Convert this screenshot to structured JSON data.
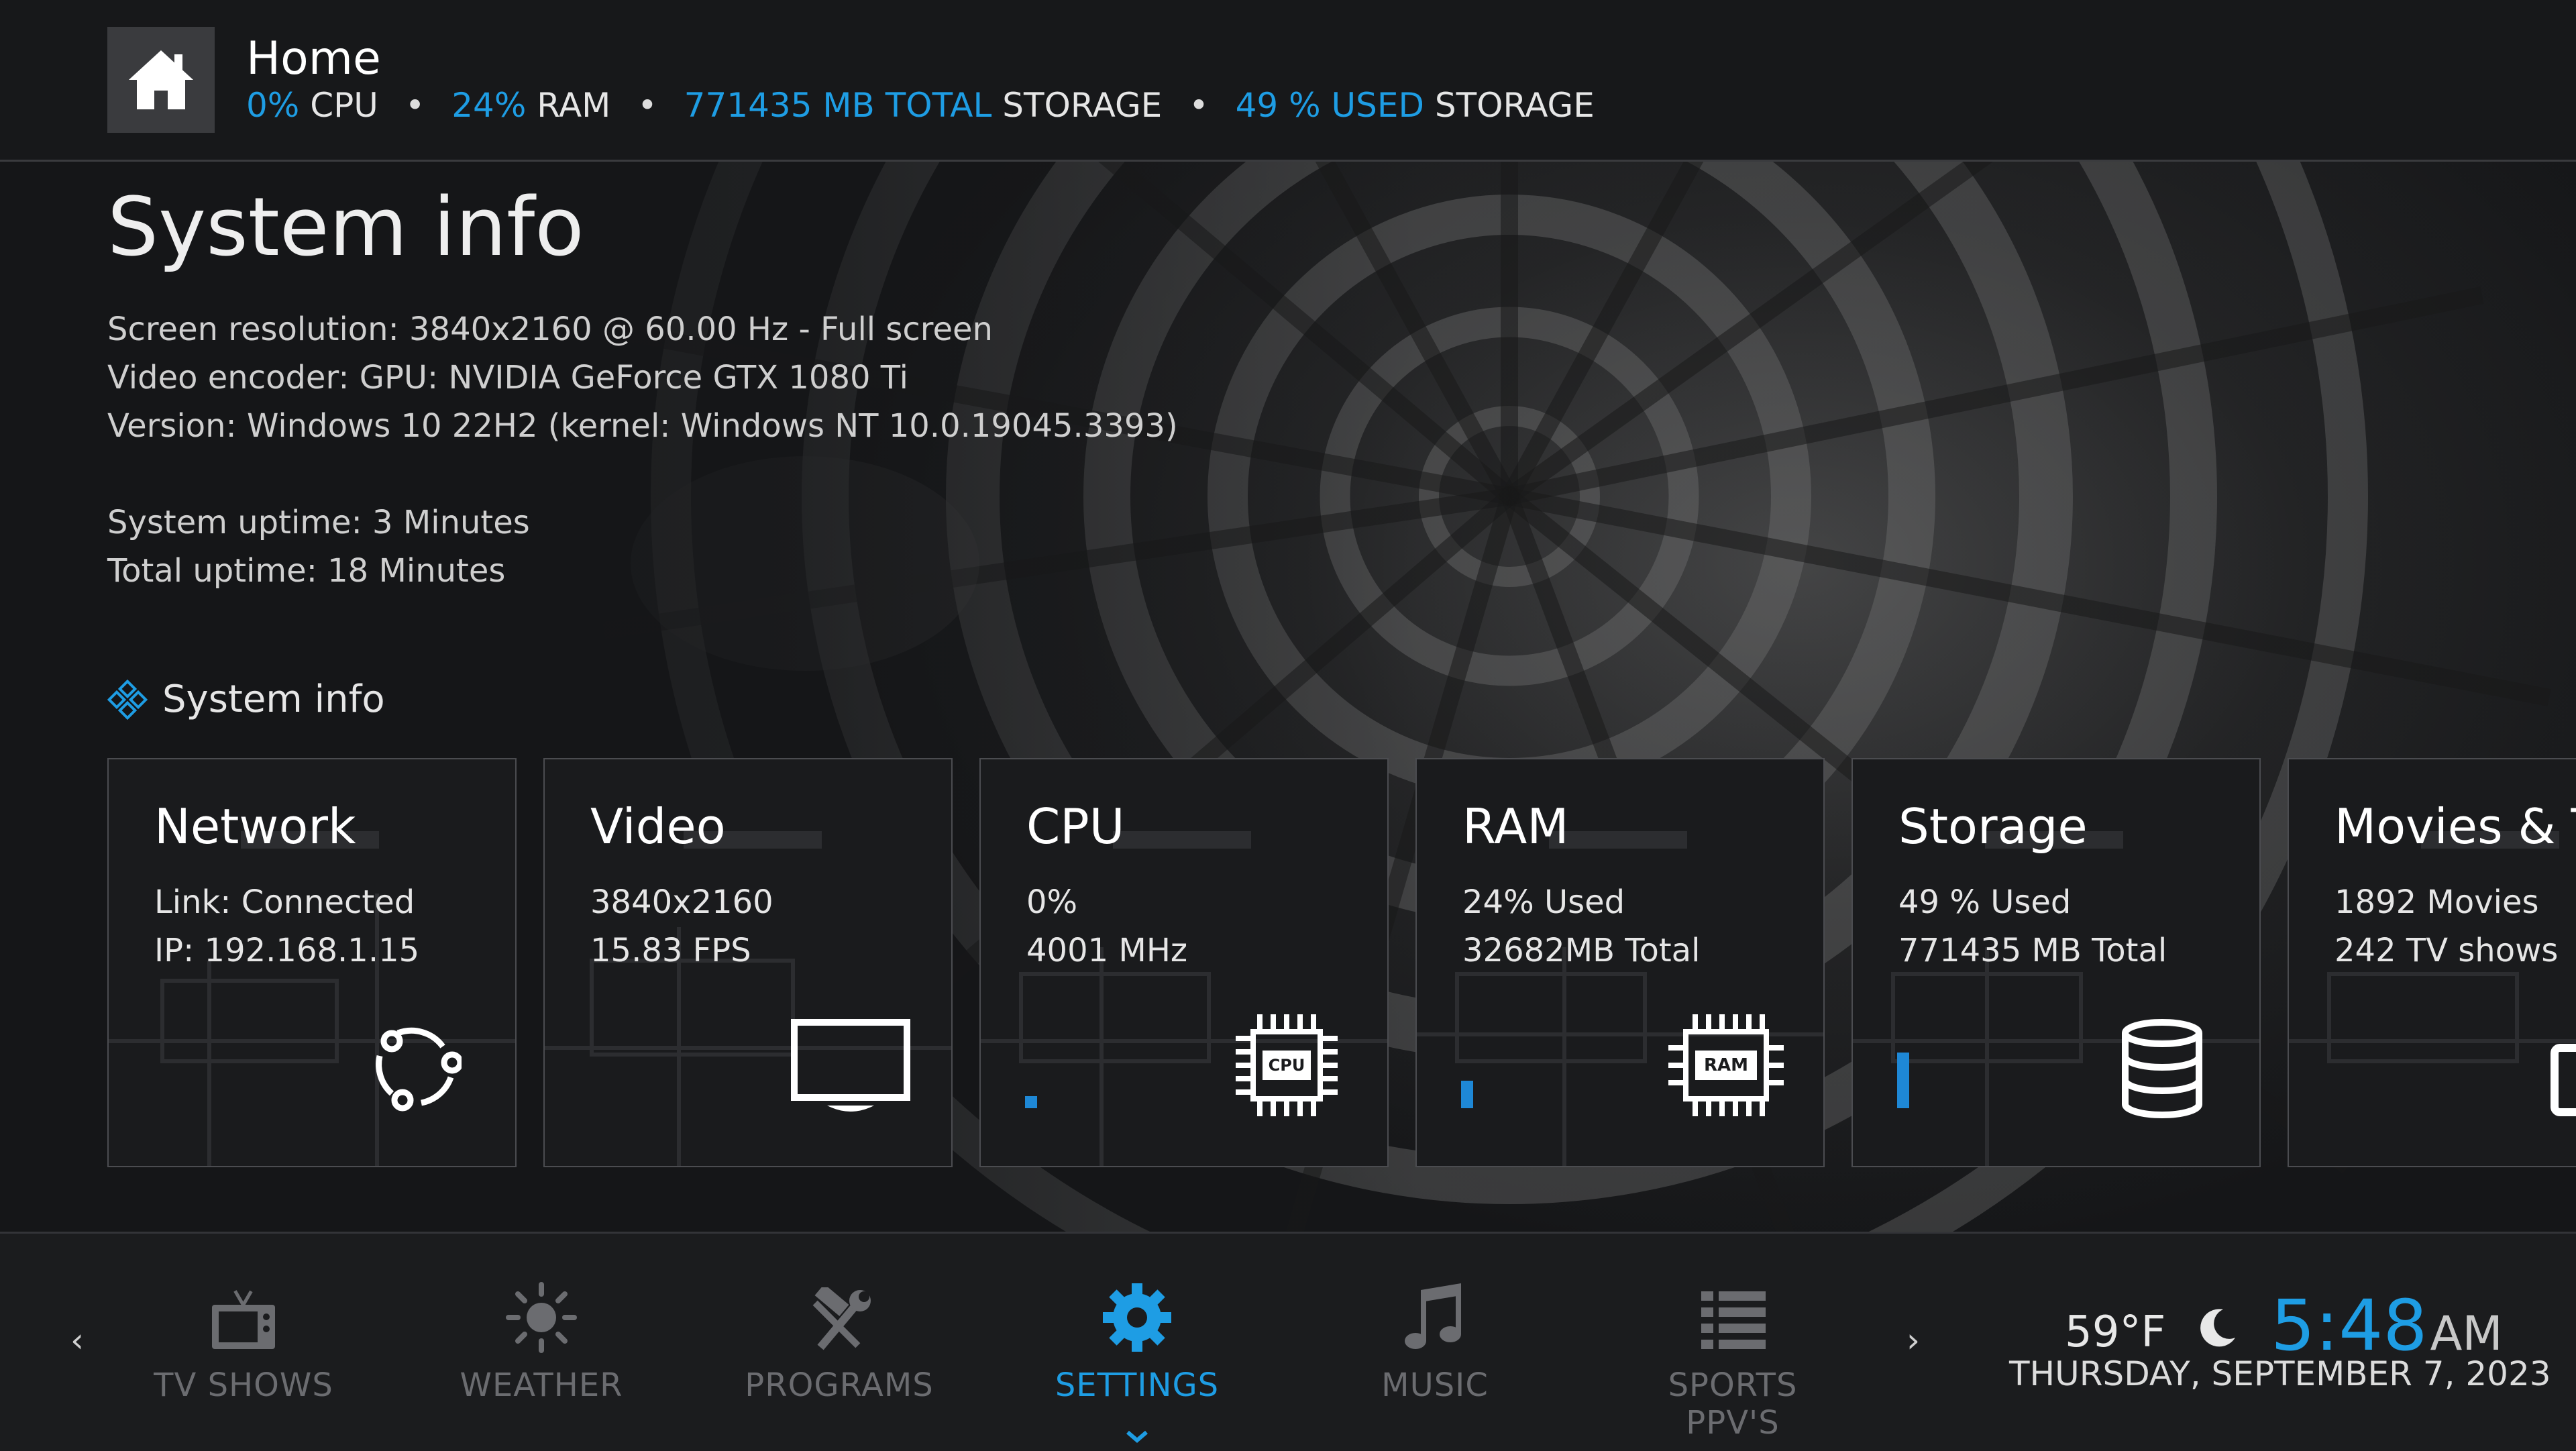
{
  "header": {
    "title": "Home",
    "stats": {
      "cpu_value": "0%",
      "cpu_label": "CPU",
      "ram_value": "24%",
      "ram_label": "RAM",
      "storage_total_value": "771435 MB TOTAL",
      "storage_total_label": "STORAGE",
      "storage_used_value": "49 % USED",
      "storage_used_label": "STORAGE",
      "separator": "•"
    }
  },
  "page": {
    "title": "System info",
    "info_lines": [
      "Screen resolution: 3840x2160 @ 60.00 Hz - Full screen",
      "Video encoder: GPU: NVIDIA GeForce GTX 1080 Ti",
      "Version: Windows 10 22H2 (kernel: Windows NT 10.0.19045.3393)"
    ],
    "uptime_lines": [
      "System uptime: 3 Minutes",
      "Total uptime: 18 Minutes"
    ],
    "section_label": "System info"
  },
  "cards": [
    {
      "title": "Network",
      "line1": "Link: Connected",
      "line2": "IP: 192.168.1.15",
      "icon": "network-icon"
    },
    {
      "title": "Video",
      "line1": "3840x2160",
      "line2": "15.83 FPS",
      "icon": "monitor-icon"
    },
    {
      "title": "CPU",
      "line1": "0%",
      "line2": "4001 MHz",
      "icon": "cpu-chip-icon",
      "chip_text": "CPU",
      "usage": 0.0
    },
    {
      "title": "RAM",
      "line1": "24% Used",
      "line2": "32682MB Total",
      "icon": "ram-chip-icon",
      "chip_text": "RAM",
      "usage": 0.24
    },
    {
      "title": "Storage",
      "line1": "49 % Used",
      "line2": "771435 MB Total",
      "icon": "database-icon",
      "usage": 0.49
    },
    {
      "title": "Movies & TV",
      "line1": "1892 Movies",
      "line2": "242 TV shows",
      "icon": "tv-library-icon"
    }
  ],
  "nav": {
    "items": [
      {
        "label": "TV SHOWS",
        "icon": "tv-icon"
      },
      {
        "label": "WEATHER",
        "icon": "sun-icon"
      },
      {
        "label": "PROGRAMS",
        "icon": "tools-icon"
      },
      {
        "label": "SETTINGS",
        "icon": "gear-icon",
        "active": true
      },
      {
        "label": "MUSIC",
        "icon": "music-note-icon"
      },
      {
        "label": "SPORTS PPV'S",
        "icon": "list-icon"
      }
    ],
    "left_arrow": "‹",
    "right_arrow": "›"
  },
  "status": {
    "temperature": "59°F",
    "time": "5:48",
    "ampm": "AM",
    "date": "THURSDAY, SEPTEMBER 7, 2023"
  },
  "colors": {
    "accent": "#1e9de4",
    "background": "#151618",
    "card_border": "#4b4c50"
  }
}
